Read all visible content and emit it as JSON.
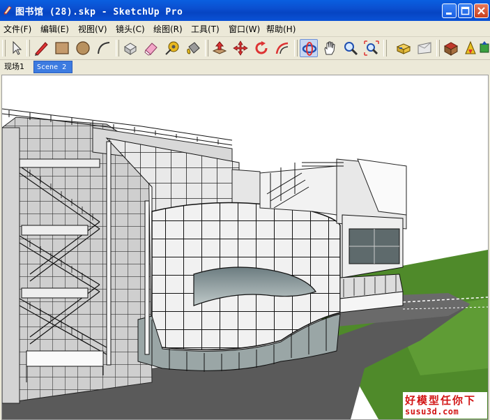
{
  "window": {
    "title": "图书馆 (28).skp - SketchUp Pro"
  },
  "menu": {
    "items": [
      {
        "label": "文件(F)"
      },
      {
        "label": "编辑(E)"
      },
      {
        "label": "视图(V)"
      },
      {
        "label": "镜头(C)"
      },
      {
        "label": "绘图(R)"
      },
      {
        "label": "工具(T)"
      },
      {
        "label": "窗口(W)"
      },
      {
        "label": "帮助(H)"
      }
    ]
  },
  "toolbar": {
    "tools": [
      {
        "icon": "select-arrow-icon"
      },
      {
        "icon": "pencil-line-icon"
      },
      {
        "icon": "rectangle-icon"
      },
      {
        "icon": "circle-icon"
      },
      {
        "icon": "arc-icon"
      },
      {
        "icon": "make-component-icon"
      },
      {
        "icon": "eraser-icon"
      },
      {
        "icon": "tape-measure-icon"
      },
      {
        "icon": "paint-bucket-icon"
      },
      {
        "icon": "push-pull-icon"
      },
      {
        "icon": "move-icon"
      },
      {
        "icon": "rotate-icon"
      },
      {
        "icon": "offset-icon"
      },
      {
        "icon": "orbit-icon"
      },
      {
        "icon": "pan-hand-icon"
      },
      {
        "icon": "zoom-icon"
      },
      {
        "icon": "zoom-extents-icon"
      },
      {
        "icon": "previous-view-icon"
      },
      {
        "icon": "next-view-icon"
      },
      {
        "icon": "3d-warehouse-icon"
      },
      {
        "icon": "get-models-icon"
      },
      {
        "icon": "share-model-icon"
      }
    ],
    "active_tool": "orbit-icon"
  },
  "scene_tabs": [
    {
      "label": "现场1",
      "active": false
    },
    {
      "label": "Scene 2",
      "active": true
    }
  ],
  "watermark": {
    "line1": "好模型任你下",
    "line2": "susu3d.com"
  },
  "colors": {
    "title_bar": "#0b4fd0",
    "active_tab": "#3d7be0",
    "ground": "#5a5a5a",
    "grass": "#4f8a2a",
    "watermark": "#d21414"
  }
}
